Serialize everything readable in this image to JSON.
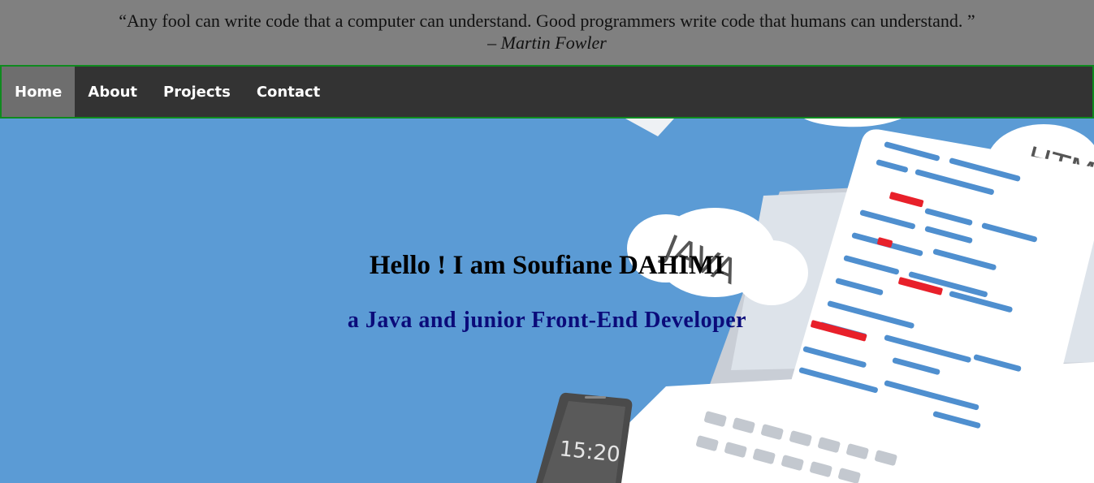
{
  "quote": {
    "text": "“Any fool can write code that a computer can understand. Good programmers write code that humans can understand. ”",
    "author": "– Martin Fowler"
  },
  "nav": {
    "items": [
      {
        "label": "Home",
        "active": true
      },
      {
        "label": "About",
        "active": false
      },
      {
        "label": "Projects",
        "active": false
      },
      {
        "label": "Contact",
        "active": false
      }
    ]
  },
  "hero": {
    "title": "Hello ! I am Soufiane DAHIMI",
    "subtitle": "a Java and junior Front-End Developer",
    "illustration": {
      "cloud_java_label": "JAVA",
      "cloud_html_label": "HTM",
      "phone_time": "15:20"
    }
  },
  "colors": {
    "quote_bg": "#808080",
    "nav_bg": "#333333",
    "nav_active_bg": "#6e6e6e",
    "nav_border": "#0f8a1f",
    "hero_bg": "#5b9bd5",
    "subtitle": "#0b0b7a"
  }
}
